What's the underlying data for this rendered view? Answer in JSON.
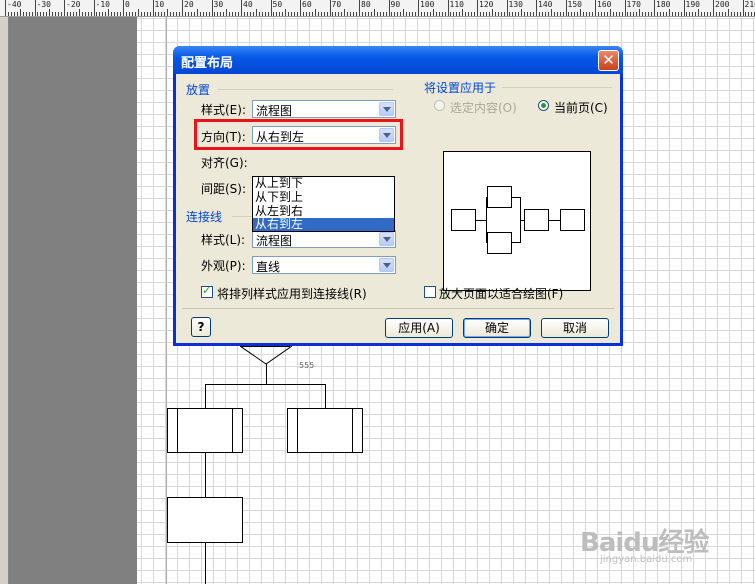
{
  "ruler": {
    "labels": [
      "-40",
      "-30",
      "-20",
      "-10",
      "0",
      "10",
      "20",
      "30",
      "40",
      "50",
      "60",
      "70",
      "80",
      "90",
      "100",
      "110",
      "120",
      "130",
      "140",
      "150",
      "160",
      "170",
      "180",
      "190",
      "200",
      "210"
    ]
  },
  "canvas": {
    "shape_label": "555"
  },
  "dialog": {
    "title": "配置布局",
    "close_glyph": "✕",
    "placement": {
      "group_title": "放置",
      "style_label": "样式(E):",
      "style_value": "流程图",
      "direction_label": "方向(T):",
      "direction_value": "从右到左",
      "align_label": "对齐(G):",
      "spacing_label": "间距(S):",
      "direction_options": [
        "从上到下",
        "从下到上",
        "从左到右",
        "从右到左"
      ],
      "selected_option_index": 3
    },
    "connectors": {
      "group_title": "连接线",
      "style_label": "样式(L):",
      "style_value": "流程图",
      "appearance_label": "外观(P):",
      "appearance_value": "直线"
    },
    "apply_settings_to": {
      "group_title": "将设置应用于",
      "selection_label": "选定内容(O)",
      "current_page_label": "当前页(C)",
      "selected": "current_page"
    },
    "apply_routing_style": {
      "label": "将排列样式应用到连接线(R)",
      "checked": true
    },
    "enlarge_page": {
      "label": "放大页面以适合绘图(F)",
      "checked": false
    },
    "buttons": {
      "help": "?",
      "apply": "应用(A)",
      "ok": "确定",
      "cancel": "取消"
    }
  },
  "watermark": {
    "text": "Baidu经验",
    "sub": "jingyan.baidu.com"
  }
}
